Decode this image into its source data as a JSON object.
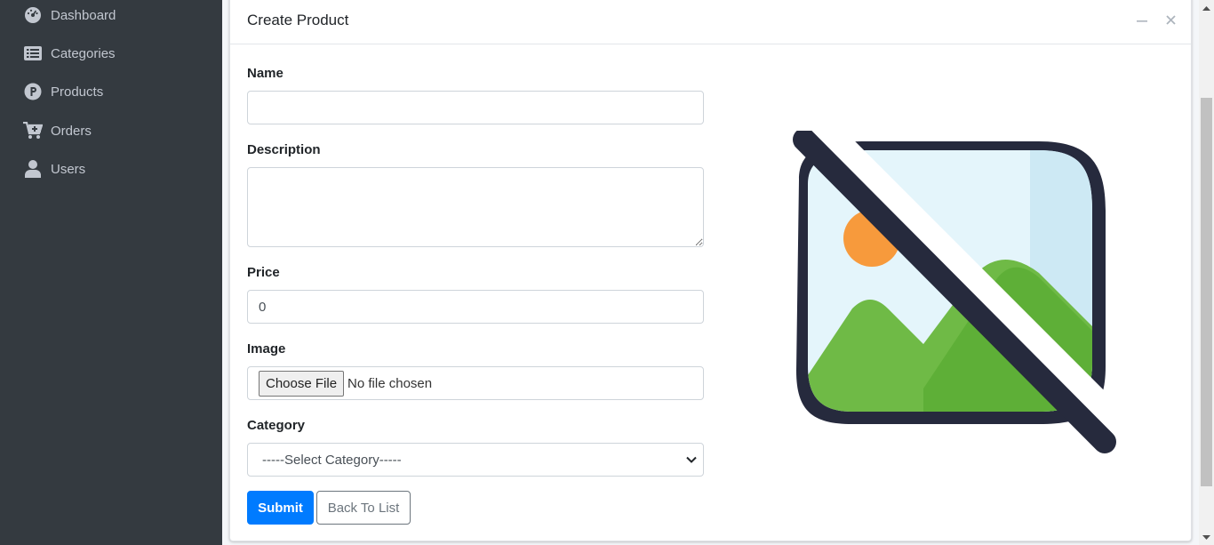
{
  "sidebar": {
    "items": [
      {
        "label": "Dashboard",
        "icon": "dashboard-icon"
      },
      {
        "label": "Categories",
        "icon": "list-icon"
      },
      {
        "label": "Products",
        "icon": "product-p-icon"
      },
      {
        "label": "Orders",
        "icon": "cart-icon"
      },
      {
        "label": "Users",
        "icon": "user-icon"
      }
    ]
  },
  "card": {
    "title": "Create Product",
    "tools": {
      "minimize_icon": "minus-icon",
      "close_icon": "close-icon"
    }
  },
  "form": {
    "name_label": "Name",
    "name_value": "",
    "description_label": "Description",
    "description_value": "",
    "price_label": "Price",
    "price_value": "0",
    "image_label": "Image",
    "file_button": "Choose File",
    "file_status": "No file chosen",
    "category_label": "Category",
    "category_selected": "-----Select Category-----",
    "submit_label": "Submit",
    "back_label": "Back To List"
  },
  "preview": {
    "icon": "no-image-icon"
  },
  "colors": {
    "sidebar_bg": "#343a40",
    "sidebar_text": "#c2c7d0",
    "primary": "#007bff",
    "secondary": "#6c757d"
  }
}
